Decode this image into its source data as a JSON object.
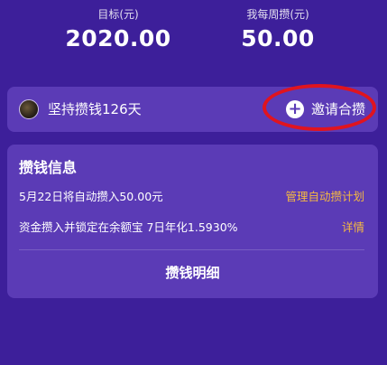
{
  "stats": {
    "target_label": "目标(元)",
    "target_value": "2020.00",
    "weekly_label": "我每周攒(元)",
    "weekly_value": "50.00"
  },
  "streak": {
    "text": "坚持攒钱126天",
    "invite_label": "邀请合攒"
  },
  "info": {
    "title": "攒钱信息",
    "auto_text": "5月22日将自动攒入50.00元",
    "auto_link": "管理自动攒计划",
    "lock_text": "资金攒入并锁定在余额宝 7日年化1.5930%",
    "lock_link": "详情",
    "details_button": "攒钱明细"
  },
  "colors": {
    "background": "#3d1f9a",
    "card": "#5b3bb6",
    "link": "#f5b942",
    "highlight_ring": "#e0141f"
  }
}
